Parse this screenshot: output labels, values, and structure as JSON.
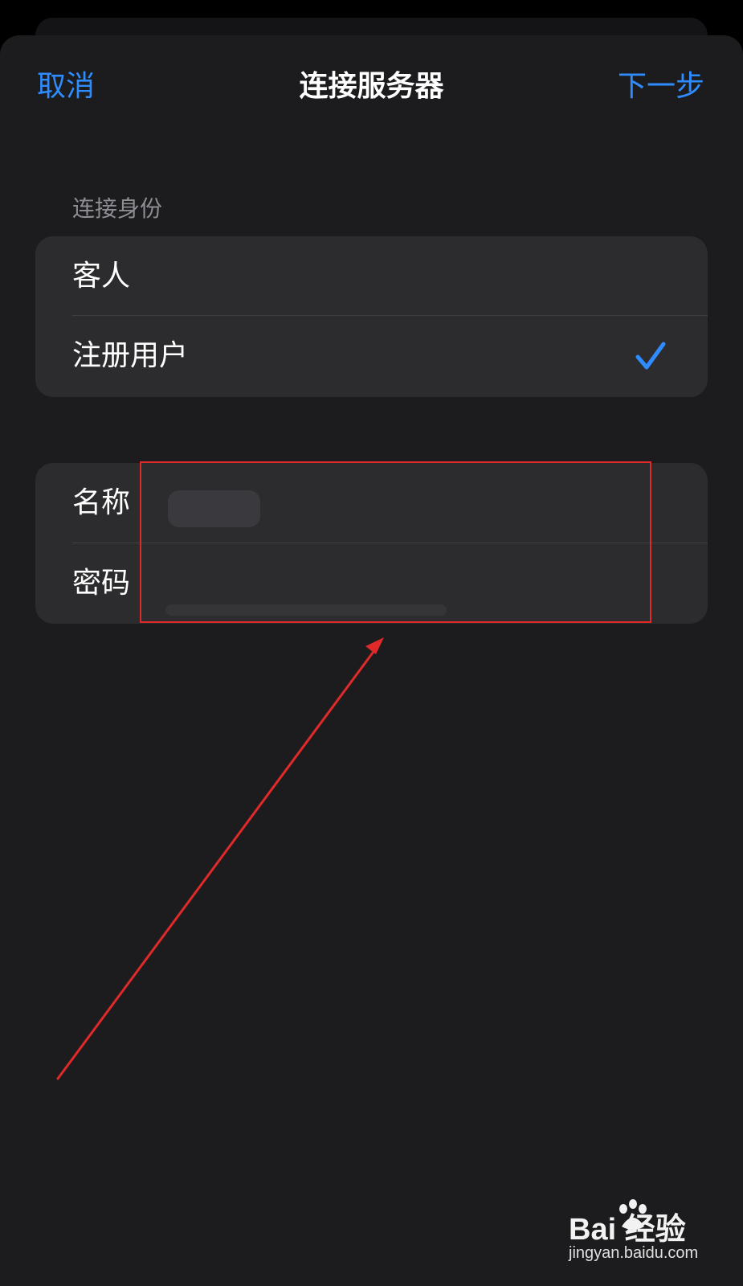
{
  "nav": {
    "cancel_label": "取消",
    "title": "连接服务器",
    "next_label": "下一步"
  },
  "identity": {
    "header": "连接身份",
    "options": [
      {
        "label": "客人",
        "selected": false
      },
      {
        "label": "注册用户",
        "selected": true
      }
    ]
  },
  "credentials": {
    "name_label": "名称",
    "name_value": "",
    "password_label": "密码",
    "password_value": ""
  },
  "colors": {
    "accent": "#2f8cff",
    "background": "#1c1c1e",
    "group_background": "#2c2c2e",
    "annotation": "#e02a2a"
  },
  "watermark": {
    "brand": "Bai  经验",
    "url": "jingyan.baidu.com"
  }
}
